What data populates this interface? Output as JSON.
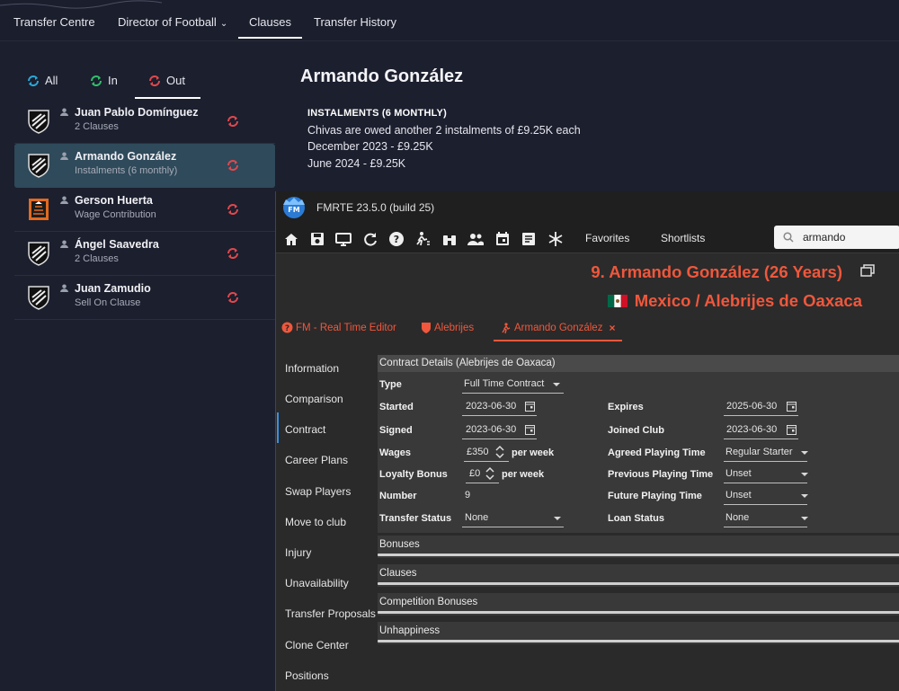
{
  "topnav": {
    "tabs": [
      {
        "label": "Transfer Centre"
      },
      {
        "label": "Director of Football"
      },
      {
        "label": "Clauses"
      },
      {
        "label": "Transfer History"
      }
    ]
  },
  "filters": {
    "all": "All",
    "in": "In",
    "out": "Out"
  },
  "players": [
    {
      "name": "Juan Pablo Domínguez",
      "sub": "2 Clauses"
    },
    {
      "name": "Armando González",
      "sub": "Instalments (6 monthly)"
    },
    {
      "name": "Gerson Huerta",
      "sub": "Wage Contribution"
    },
    {
      "name": "Ángel Saavedra",
      "sub": "2 Clauses"
    },
    {
      "name": "Juan Zamudio",
      "sub": "Sell On Clause"
    }
  ],
  "detail": {
    "title": "Armando González",
    "heading": "INSTALMENTS (6 MONTHLY)",
    "lines": [
      "Chivas are owed another 2 instalments of £9.25K each",
      "December 2023 - £9.25K",
      "June 2024 - £9.25K"
    ]
  },
  "fmrte": {
    "title": "FMRTE 23.5.0 (build 25)",
    "toolbar": {
      "favorites": "Favorites",
      "shortlists": "Shortlists",
      "search_value": "armando"
    },
    "player_header": "9. Armando González (26 Years)",
    "nation_club": "Mexico / Alebrijes de Oaxaca",
    "tabs": [
      {
        "label": "FM - Real Time Editor"
      },
      {
        "label": "Alebrijes"
      },
      {
        "label": "Armando González"
      }
    ],
    "tab_close": "×",
    "sidenav": [
      "Information",
      "Comparison",
      "Contract",
      "Career Plans",
      "Swap Players",
      "Move to club",
      "Injury",
      "Unavailability",
      "Transfer Proposals",
      "Clone Center",
      "Positions"
    ],
    "contract": {
      "title": "Contract Details (Alebrijes de Oaxaca)",
      "type_label": "Type",
      "type_value": "Full Time Contract",
      "started_label": "Started",
      "started_value": "2023-06-30",
      "expires_label": "Expires",
      "expires_value": "2025-06-30",
      "signed_label": "Signed",
      "signed_value": "2023-06-30",
      "joined_label": "Joined Club",
      "joined_value": "2023-06-30",
      "wages_label": "Wages",
      "wages_value": "£350",
      "per_week": "per week",
      "agreed_label": "Agreed Playing Time",
      "agreed_value": "Regular Starter",
      "loyalty_label": "Loyalty Bonus",
      "loyalty_value": "£0",
      "prev_label": "Previous Playing Time",
      "prev_value": "Unset",
      "number_label": "Number",
      "number_value": "9",
      "future_label": "Future Playing Time",
      "future_value": "Unset",
      "transfer_label": "Transfer Status",
      "transfer_value": "None",
      "loan_label": "Loan Status",
      "loan_value": "None"
    },
    "sections": [
      "Bonuses",
      "Clauses",
      "Competition Bonuses",
      "Unhappiness"
    ]
  },
  "colors": {
    "accent": "#f0573c",
    "selected_row": "#2f4a5a",
    "background": "#1c1f2e"
  }
}
